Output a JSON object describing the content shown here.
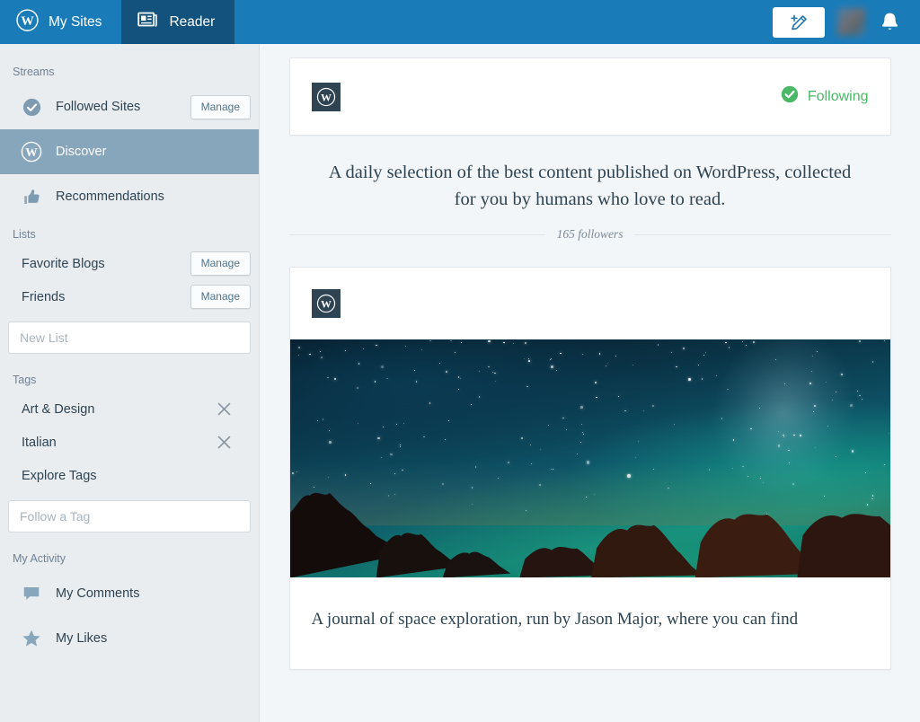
{
  "masthead": {
    "my_sites_label": "My Sites",
    "reader_label": "Reader",
    "write_icon": "pencil-plus-icon",
    "avatar_icon": "user-avatar",
    "bell_icon": "bell-icon",
    "bar_color": "#1a7bb9",
    "active_tab_color": "#12527c"
  },
  "sidebar": {
    "streams_heading": "Streams",
    "streams": [
      {
        "label": "Followed Sites",
        "icon": "checkmark-circle-icon",
        "manage_label": "Manage",
        "active": false
      },
      {
        "label": "Discover",
        "icon": "wordpress-icon",
        "active": true
      },
      {
        "label": "Recommendations",
        "icon": "thumbs-up-icon",
        "active": false
      }
    ],
    "lists_heading": "Lists",
    "lists": [
      {
        "label": "Favorite Blogs",
        "manage_label": "Manage"
      },
      {
        "label": "Friends",
        "manage_label": "Manage"
      }
    ],
    "new_list_placeholder": "New List",
    "tags_heading": "Tags",
    "tags": [
      {
        "label": "Art & Design",
        "remove_icon": "close-icon"
      },
      {
        "label": "Italian",
        "remove_icon": "close-icon"
      }
    ],
    "explore_tags_label": "Explore Tags",
    "follow_tag_placeholder": "Follow a Tag",
    "activity_heading": "My Activity",
    "activity": [
      {
        "label": "My Comments",
        "icon": "comment-bubble-icon"
      },
      {
        "label": "My Likes",
        "icon": "star-icon"
      }
    ],
    "active_row_color": "#87a6bc",
    "background_color": "#e9edf0"
  },
  "main": {
    "card1": {
      "site_icon": "wordpress-icon",
      "site_name_redacted": true,
      "following_label": "Following",
      "following_icon": "checkmark-circle-icon",
      "following_color": "#4ab866",
      "description": "A daily selection of the best content published on WordPress, collected for you by humans who love to read.",
      "followers_text": "165 followers"
    },
    "card2": {
      "site_icon": "wordpress-icon",
      "site_name_redacted": true,
      "featured_image_alt": "night-sky-with-stars-and-tree-silhouettes",
      "excerpt": "A journal of space exploration, run by Jason Major, where you can find"
    }
  }
}
